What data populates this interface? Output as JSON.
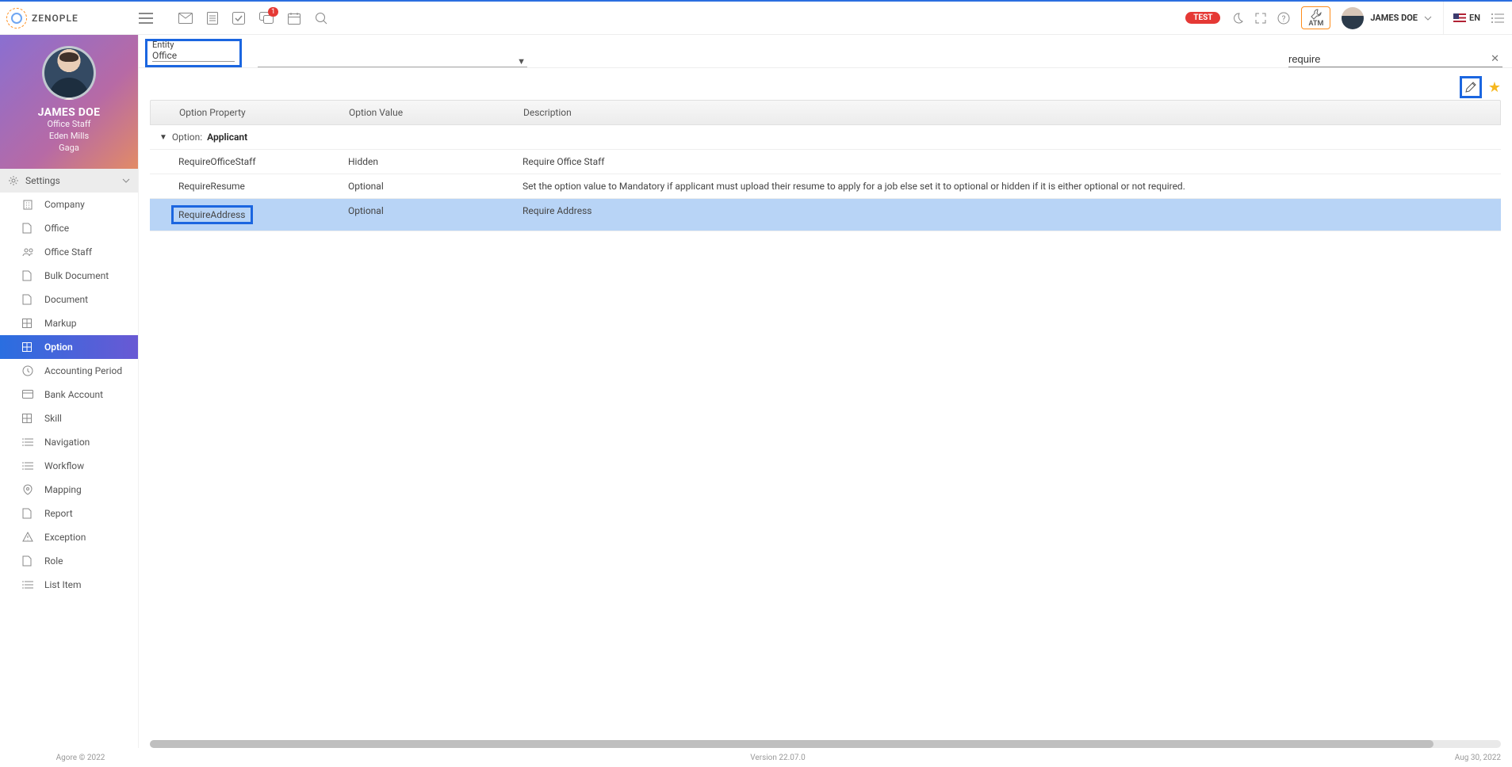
{
  "brand": "ZENOPLE",
  "topbar": {
    "test_badge": "TEST",
    "atm_label": "ATM",
    "user_name": "JAMES DOE",
    "lang": "EN",
    "notif_count": "1"
  },
  "profile": {
    "name": "JAMES DOE",
    "role": "Office Staff",
    "location": "Eden Mills",
    "extra": "Gaga"
  },
  "sidebar": {
    "section": "Settings",
    "items": [
      {
        "icon": "building",
        "label": "Company"
      },
      {
        "icon": "file",
        "label": "Office"
      },
      {
        "icon": "people",
        "label": "Office Staff"
      },
      {
        "icon": "file",
        "label": "Bulk Document"
      },
      {
        "icon": "file",
        "label": "Document"
      },
      {
        "icon": "grid",
        "label": "Markup"
      },
      {
        "icon": "grid",
        "label": "Option"
      },
      {
        "icon": "clock",
        "label": "Accounting Period"
      },
      {
        "icon": "card",
        "label": "Bank Account"
      },
      {
        "icon": "grid",
        "label": "Skill"
      },
      {
        "icon": "list",
        "label": "Navigation"
      },
      {
        "icon": "list",
        "label": "Workflow"
      },
      {
        "icon": "map",
        "label": "Mapping"
      },
      {
        "icon": "file",
        "label": "Report"
      },
      {
        "icon": "warn",
        "label": "Exception"
      },
      {
        "icon": "file",
        "label": "Role"
      },
      {
        "icon": "list",
        "label": "List Item"
      }
    ],
    "active_index": 6
  },
  "filter": {
    "entity_label": "Entity",
    "entity_value": "Office",
    "search_value": "require"
  },
  "grid": {
    "headers": {
      "prop": "Option Property",
      "val": "Option Value",
      "desc": "Description"
    },
    "group": {
      "label": "Option:",
      "value": "Applicant"
    },
    "rows": [
      {
        "prop": "RequireOfficeStaff",
        "val": "Hidden",
        "desc": "Require Office Staff",
        "selected": false,
        "hilite": false
      },
      {
        "prop": "RequireResume",
        "val": "Optional",
        "desc": "Set the option value to Mandatory if applicant must upload their resume to apply for a job else set it to optional or hidden if it is either optional or not required.",
        "selected": false,
        "hilite": false
      },
      {
        "prop": "RequireAddress",
        "val": "Optional",
        "desc": "Require Address",
        "selected": true,
        "hilite": true
      }
    ]
  },
  "footer": {
    "left": "Agore © 2022",
    "center": "Version 22.07.0",
    "right": "Aug 30, 2022"
  }
}
